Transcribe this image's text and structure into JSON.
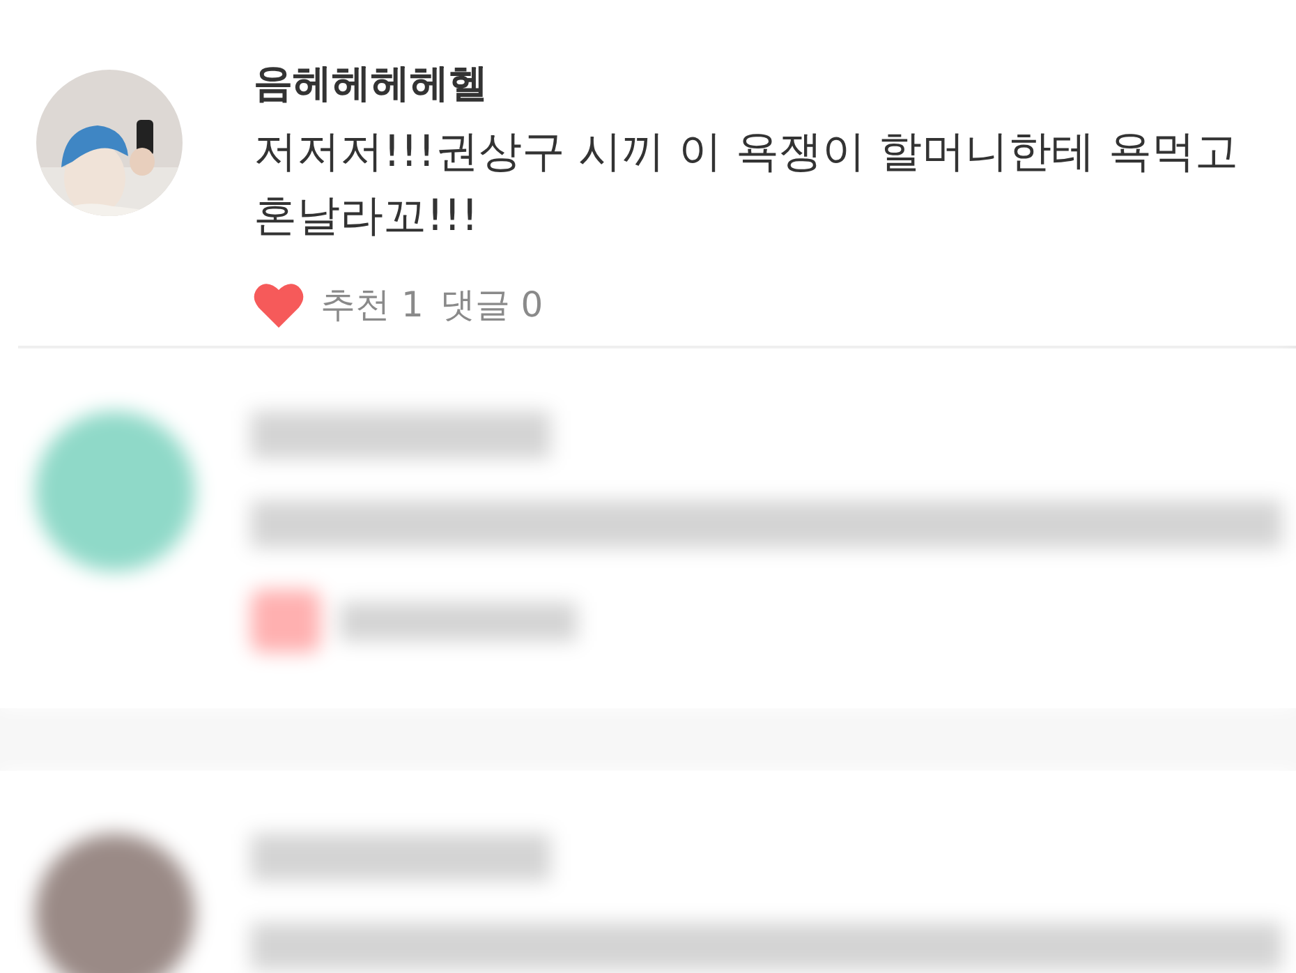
{
  "comment": {
    "author": "음헤헤헤헤헬",
    "text": "저저저!!!권상구 시끼 이 욕쟁이 할머니한테 욕먹고 혼날라꼬!!!",
    "liked": true,
    "likes_label": "추천 1",
    "replies_label": "댓글 0"
  },
  "blurred_comments": [
    {
      "kind": "blurred",
      "color": "#8fd9c8"
    },
    {
      "kind": "blurred",
      "color": "#9a8a86"
    }
  ]
}
